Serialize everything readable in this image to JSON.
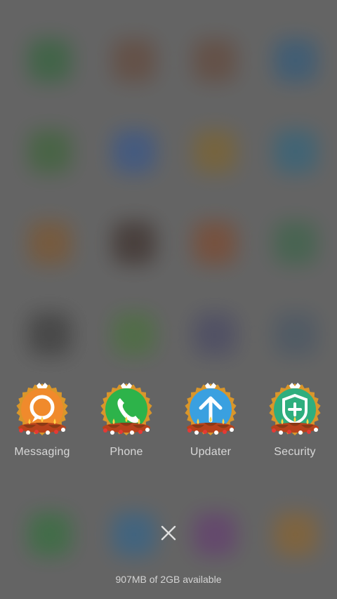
{
  "background_apps": [
    {
      "color": "#2f6b3a"
    },
    {
      "color": "#6b4a3a"
    },
    {
      "color": "#6b4a3a"
    },
    {
      "color": "#2e5f86"
    },
    {
      "color": "#3b6b36"
    },
    {
      "color": "#345a9a"
    },
    {
      "color": "#8a6a2a"
    },
    {
      "color": "#2e6a88"
    },
    {
      "color": "#8a5a2a"
    },
    {
      "color": "#3b2b26"
    },
    {
      "color": "#8a4a2a"
    },
    {
      "color": "#3a6a4a"
    },
    {
      "color": "#3a3a3a"
    },
    {
      "color": "#4a7a3a"
    },
    {
      "color": "#4a4a6a"
    },
    {
      "color": "#4a5a6a"
    },
    {
      "color": "#2f7a3a"
    },
    {
      "color": "#2e6a9a"
    },
    {
      "color": "#6a3a7a"
    },
    {
      "color": "#9a6a2a"
    }
  ],
  "recent_apps": [
    {
      "label": "Messaging",
      "icon": "messaging-icon",
      "color": "#f08a2c"
    },
    {
      "label": "Phone",
      "icon": "phone-icon",
      "color": "#2db34a"
    },
    {
      "label": "Updater",
      "icon": "updater-icon",
      "color": "#3aa0e0"
    },
    {
      "label": "Security",
      "icon": "security-icon",
      "color": "#2fae7e"
    }
  ],
  "close_icon": "close-icon",
  "memory_status": "907MB of 2GB available"
}
